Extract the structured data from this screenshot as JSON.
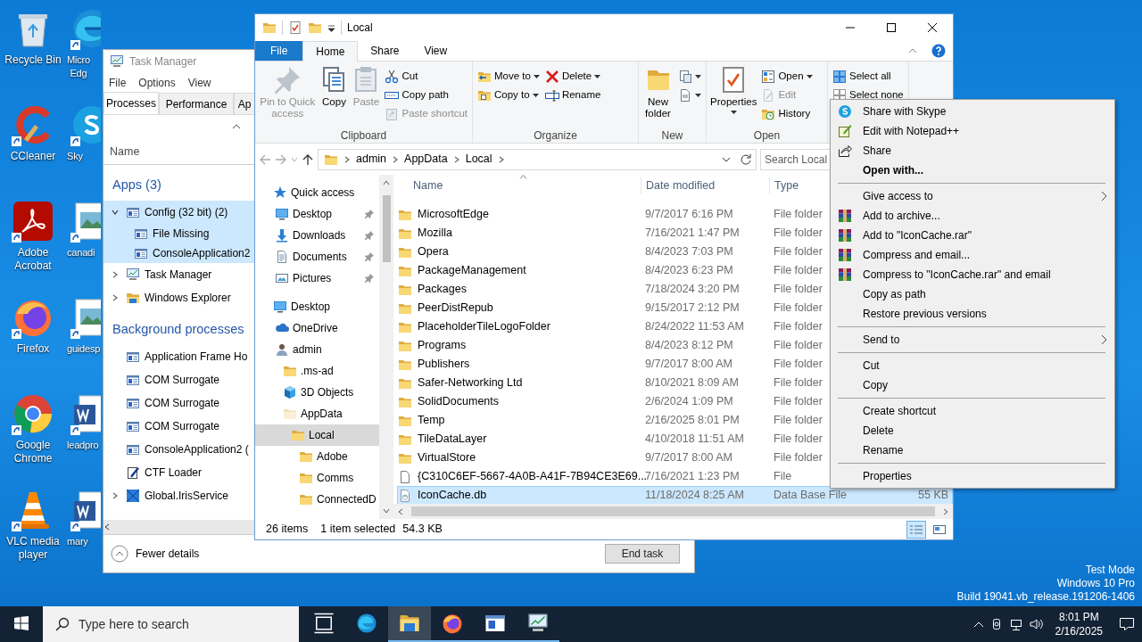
{
  "desktop_icons": [
    {
      "label": [
        "Recycle Bin"
      ],
      "kind": "recycle"
    },
    {
      "label": [
        "CCleaner"
      ],
      "kind": "ccleaner"
    },
    {
      "label": [
        "Adobe",
        "Acrobat"
      ],
      "kind": "acrobat"
    },
    {
      "label": [
        "Firefox"
      ],
      "kind": "firefox"
    },
    {
      "label": [
        "Google",
        "Chrome"
      ],
      "kind": "chrome"
    },
    {
      "label": [
        "VLC media",
        "player"
      ],
      "kind": "vlc"
    }
  ],
  "desktop_icons_partial": [
    {
      "label": [
        "Micro",
        "Edg"
      ],
      "kind": "edge"
    },
    {
      "label": [
        "Sky"
      ],
      "kind": "skype"
    },
    {
      "label": [
        "canadi"
      ],
      "kind": "image"
    },
    {
      "label": [
        "guidesp"
      ],
      "kind": "image"
    },
    {
      "label": [
        "leadpro"
      ],
      "kind": "word"
    },
    {
      "label": [
        "mary"
      ],
      "kind": "word"
    }
  ],
  "system_info": [
    "Test Mode",
    "Windows 10 Pro",
    "Build 19041.vb_release.191206-1406"
  ],
  "task_manager": {
    "title": "Task Manager",
    "menu": [
      "File",
      "Options",
      "View"
    ],
    "tabs": [
      {
        "label": "Processes",
        "selected": true
      },
      {
        "label": "Performance",
        "selected": false
      },
      {
        "label": "Ap",
        "selected": false
      }
    ],
    "column": "Name",
    "groups": [
      {
        "title": "Apps (3)",
        "items": [
          {
            "name": "Config (32 bit) (2)",
            "kind": "app",
            "expanded": true,
            "selected": true,
            "children": [
              {
                "name": "File Missing",
                "kind": "app"
              },
              {
                "name": "ConsoleApplication2",
                "kind": "app"
              }
            ]
          },
          {
            "name": "Task Manager",
            "kind": "taskmgr",
            "expanded": false,
            "selected": false
          },
          {
            "name": "Windows Explorer",
            "kind": "explorer",
            "expanded": false,
            "selected": false
          }
        ]
      },
      {
        "title": "Background processes",
        "items": [
          {
            "name": "Application Frame Ho",
            "kind": "app",
            "selected": false
          },
          {
            "name": "COM Surrogate",
            "kind": "app",
            "selected": false
          },
          {
            "name": "COM Surrogate",
            "kind": "app",
            "selected": false
          },
          {
            "name": "COM Surrogate",
            "kind": "app",
            "selected": false
          },
          {
            "name": "ConsoleApplication2 (",
            "kind": "app",
            "selected": false
          },
          {
            "name": "CTF Loader",
            "kind": "ctf",
            "selected": false
          },
          {
            "name": "Global.IrisService",
            "kind": "iris",
            "expanded": false,
            "selected": false
          }
        ]
      }
    ],
    "fewer_details": "Fewer details",
    "end_task": "End task"
  },
  "explorer": {
    "title": "Local",
    "ribbon_tabs": [
      {
        "label": "File",
        "kind": "file",
        "selected": false
      },
      {
        "label": "Home",
        "kind": "tab",
        "selected": true
      },
      {
        "label": "Share",
        "kind": "tab",
        "selected": false
      },
      {
        "label": "View",
        "kind": "tab",
        "selected": false
      }
    ],
    "ribbon_groups": [
      {
        "label": "Clipboard",
        "columns": [
          [
            {
              "label": "Pin to Quick access",
              "kind": "pin",
              "disabled": true,
              "dropdown": false
            }
          ],
          [
            {
              "label": "Copy",
              "kind": "copy",
              "disabled": false,
              "dropdown": false
            }
          ],
          [
            {
              "label": "Paste",
              "kind": "paste",
              "disabled": true,
              "dropdown": false
            }
          ],
          [
            {
              "label": "Cut",
              "kind": "cut",
              "disabled": false,
              "dropdown": false
            },
            {
              "label": "Copy path",
              "kind": "copypath",
              "disabled": false,
              "dropdown": false
            },
            {
              "label": "Paste shortcut",
              "kind": "pasteshortcut",
              "disabled": true,
              "dropdown": false
            }
          ]
        ]
      },
      {
        "label": "Organize",
        "columns": [
          [
            {
              "label": "Move to",
              "kind": "moveto",
              "disabled": false,
              "dropdown": true
            },
            {
              "label": "Copy to",
              "kind": "copyto",
              "disabled": false,
              "dropdown": true
            }
          ],
          [
            {
              "label": "Delete",
              "kind": "delete",
              "disabled": false,
              "dropdown": true
            },
            {
              "label": "Rename",
              "kind": "rename",
              "disabled": false,
              "dropdown": false
            }
          ]
        ]
      },
      {
        "label": "New",
        "columns": [
          [
            {
              "label": "New folder",
              "kind": "newfolder",
              "disabled": false,
              "dropdown": false
            }
          ],
          [
            {
              "kind": "newitem",
              "disabled": false,
              "dropdown": true
            },
            {
              "kind": "easyaccess",
              "disabled": false,
              "dropdown": true
            }
          ]
        ]
      },
      {
        "label": "Open",
        "columns": [
          [
            {
              "label": "Properties",
              "kind": "properties",
              "disabled": false,
              "dropdown": true
            }
          ],
          [
            {
              "label": "Open",
              "kind": "open",
              "disabled": false,
              "dropdown": true
            },
            {
              "label": "Edit",
              "kind": "edit",
              "disabled": true,
              "dropdown": false
            },
            {
              "label": "History",
              "kind": "history",
              "disabled": false,
              "dropdown": false
            }
          ]
        ]
      },
      {
        "columns": [
          [
            {
              "label": "Select all",
              "kind": "selectall",
              "disabled": false,
              "dropdown": false
            },
            {
              "label": "Select none",
              "kind": "selectnone",
              "disabled": false,
              "dropdown": false
            }
          ]
        ]
      }
    ],
    "path": [
      "admin",
      "AppData",
      "Local"
    ],
    "search": {
      "placeholder": "Search Local"
    },
    "nav": [
      {
        "label": "Quick access",
        "kind": "star",
        "selected": false,
        "children": [
          {
            "label": "Desktop",
            "kind": "desktop",
            "pinned": true,
            "selected": false
          },
          {
            "label": "Downloads",
            "kind": "downloads",
            "pinned": true,
            "selected": false
          },
          {
            "label": "Documents",
            "kind": "documents",
            "pinned": true,
            "selected": false
          },
          {
            "label": "Pictures",
            "kind": "pictures",
            "pinned": true,
            "selected": false
          }
        ]
      },
      {
        "label": "Desktop",
        "kind": "desktop",
        "selected": false,
        "children": [
          {
            "label": "OneDrive",
            "kind": "onedrive",
            "selected": false
          },
          {
            "label": "admin",
            "kind": "user",
            "selected": false,
            "children": [
              {
                "label": ".ms-ad",
                "kind": "folder",
                "selected": false
              },
              {
                "label": "3D Objects",
                "kind": "cube",
                "selected": false
              },
              {
                "label": "AppData",
                "kind": "palefolder",
                "selected": false,
                "children": [
                  {
                    "label": "Local",
                    "kind": "folder",
                    "selected": true,
                    "children": [
                      {
                        "label": "Adobe",
                        "kind": "folder",
                        "selected": false
                      },
                      {
                        "label": "Comms",
                        "kind": "folder",
                        "selected": false
                      },
                      {
                        "label": "ConnectedD",
                        "kind": "folder",
                        "selected": false
                      }
                    ]
                  }
                ]
              }
            ]
          }
        ]
      }
    ],
    "columns": [
      "Name",
      "Date modified",
      "Type"
    ],
    "files": [
      {
        "name": "MicrosoftEdge",
        "date": "9/7/2017 6:16 PM",
        "type": "File folder",
        "kind": "folder",
        "selected": false
      },
      {
        "name": "Mozilla",
        "date": "7/16/2021 1:47 PM",
        "type": "File folder",
        "kind": "folder",
        "selected": false
      },
      {
        "name": "Opera",
        "date": "8/4/2023 7:03 PM",
        "type": "File folder",
        "kind": "folder",
        "selected": false
      },
      {
        "name": "PackageManagement",
        "date": "8/4/2023 6:23 PM",
        "type": "File folder",
        "kind": "folder",
        "selected": false
      },
      {
        "name": "Packages",
        "date": "7/18/2024 3:20 PM",
        "type": "File folder",
        "kind": "folder",
        "selected": false
      },
      {
        "name": "PeerDistRepub",
        "date": "9/15/2017 2:12 PM",
        "type": "File folder",
        "kind": "folder",
        "selected": false
      },
      {
        "name": "PlaceholderTileLogoFolder",
        "date": "8/24/2022 11:53 AM",
        "type": "File folder",
        "kind": "folder",
        "selected": false
      },
      {
        "name": "Programs",
        "date": "8/4/2023 8:12 PM",
        "type": "File folder",
        "kind": "folder",
        "selected": false
      },
      {
        "name": "Publishers",
        "date": "9/7/2017 8:00 AM",
        "type": "File folder",
        "kind": "folder",
        "selected": false
      },
      {
        "name": "Safer-Networking Ltd",
        "date": "8/10/2021 8:09 AM",
        "type": "File folder",
        "kind": "folder",
        "selected": false
      },
      {
        "name": "SolidDocuments",
        "date": "2/6/2024 1:09 PM",
        "type": "File folder",
        "kind": "folder",
        "selected": false
      },
      {
        "name": "Temp",
        "date": "2/16/2025 8:01 PM",
        "type": "File folder",
        "kind": "folder",
        "selected": false
      },
      {
        "name": "TileDataLayer",
        "date": "4/10/2018 11:51 AM",
        "type": "File folder",
        "kind": "folder",
        "selected": false
      },
      {
        "name": "VirtualStore",
        "date": "9/7/2017 8:00 AM",
        "type": "File folder",
        "kind": "folder",
        "selected": false
      },
      {
        "name": "{C310C6EF-5667-4A0B-A41F-7B94CE3E69...",
        "date": "7/16/2021 1:23 PM",
        "type": "File",
        "kind": "file",
        "selected": false
      },
      {
        "name": "IconCache.db",
        "date": "11/18/2024 8:25 AM",
        "type": "Data Base File",
        "size": "55 KB",
        "kind": "db",
        "selected": true
      }
    ],
    "status": {
      "count": "26 items",
      "selection": "1 item selected",
      "size": "54.3 KB"
    },
    "views": [
      {
        "kind": "details",
        "selected": true
      },
      {
        "kind": "largeicons",
        "selected": false
      }
    ]
  },
  "context_menu": [
    {
      "kind": "skype",
      "label": "Share with Skype",
      "default": false,
      "submenu": false
    },
    {
      "kind": "notepad",
      "label": "Edit with Notepad++",
      "default": false,
      "submenu": false
    },
    {
      "kind": "share",
      "label": "Share",
      "default": false,
      "submenu": false
    },
    {
      "kind": "plain",
      "label": "Open with...",
      "default": true,
      "submenu": false
    },
    {
      "kind": "separator"
    },
    {
      "kind": "plain",
      "label": "Give access to",
      "default": false,
      "submenu": true
    },
    {
      "kind": "winrar",
      "label": "Add to archive...",
      "default": false,
      "submenu": false
    },
    {
      "kind": "winrar",
      "label": "Add to \"IconCache.rar\"",
      "default": false,
      "submenu": false
    },
    {
      "kind": "winrar",
      "label": "Compress and email...",
      "default": false,
      "submenu": false
    },
    {
      "kind": "winrar",
      "label": "Compress to \"IconCache.rar\" and email",
      "default": false,
      "submenu": false
    },
    {
      "kind": "plain",
      "label": "Copy as path",
      "default": false,
      "submenu": false
    },
    {
      "kind": "plain",
      "label": "Restore previous versions",
      "default": false,
      "submenu": false
    },
    {
      "kind": "separator"
    },
    {
      "kind": "plain",
      "label": "Send to",
      "default": false,
      "submenu": true
    },
    {
      "kind": "separator"
    },
    {
      "kind": "plain",
      "label": "Cut",
      "default": false,
      "submenu": false
    },
    {
      "kind": "plain",
      "label": "Copy",
      "default": false,
      "submenu": false
    },
    {
      "kind": "separator"
    },
    {
      "kind": "plain",
      "label": "Create shortcut",
      "default": false,
      "submenu": false
    },
    {
      "kind": "plain",
      "label": "Delete",
      "default": false,
      "submenu": false
    },
    {
      "kind": "plain",
      "label": "Rename",
      "default": false,
      "submenu": false
    },
    {
      "kind": "separator"
    },
    {
      "kind": "plain",
      "label": "Properties",
      "default": false,
      "submenu": false
    }
  ],
  "taskbar": {
    "search": {
      "placeholder": "Type here to search"
    },
    "apps": [
      {
        "kind": "taskview",
        "running": false,
        "active": false
      },
      {
        "kind": "edge",
        "running": false,
        "active": false
      },
      {
        "kind": "explorer",
        "running": true,
        "active": true
      },
      {
        "kind": "firefox",
        "running": true,
        "active": false
      },
      {
        "kind": "window",
        "running": true,
        "active": false
      },
      {
        "kind": "taskmgr",
        "running": true,
        "active": false
      }
    ],
    "time": "8:01 PM",
    "date": "2/16/2025"
  }
}
